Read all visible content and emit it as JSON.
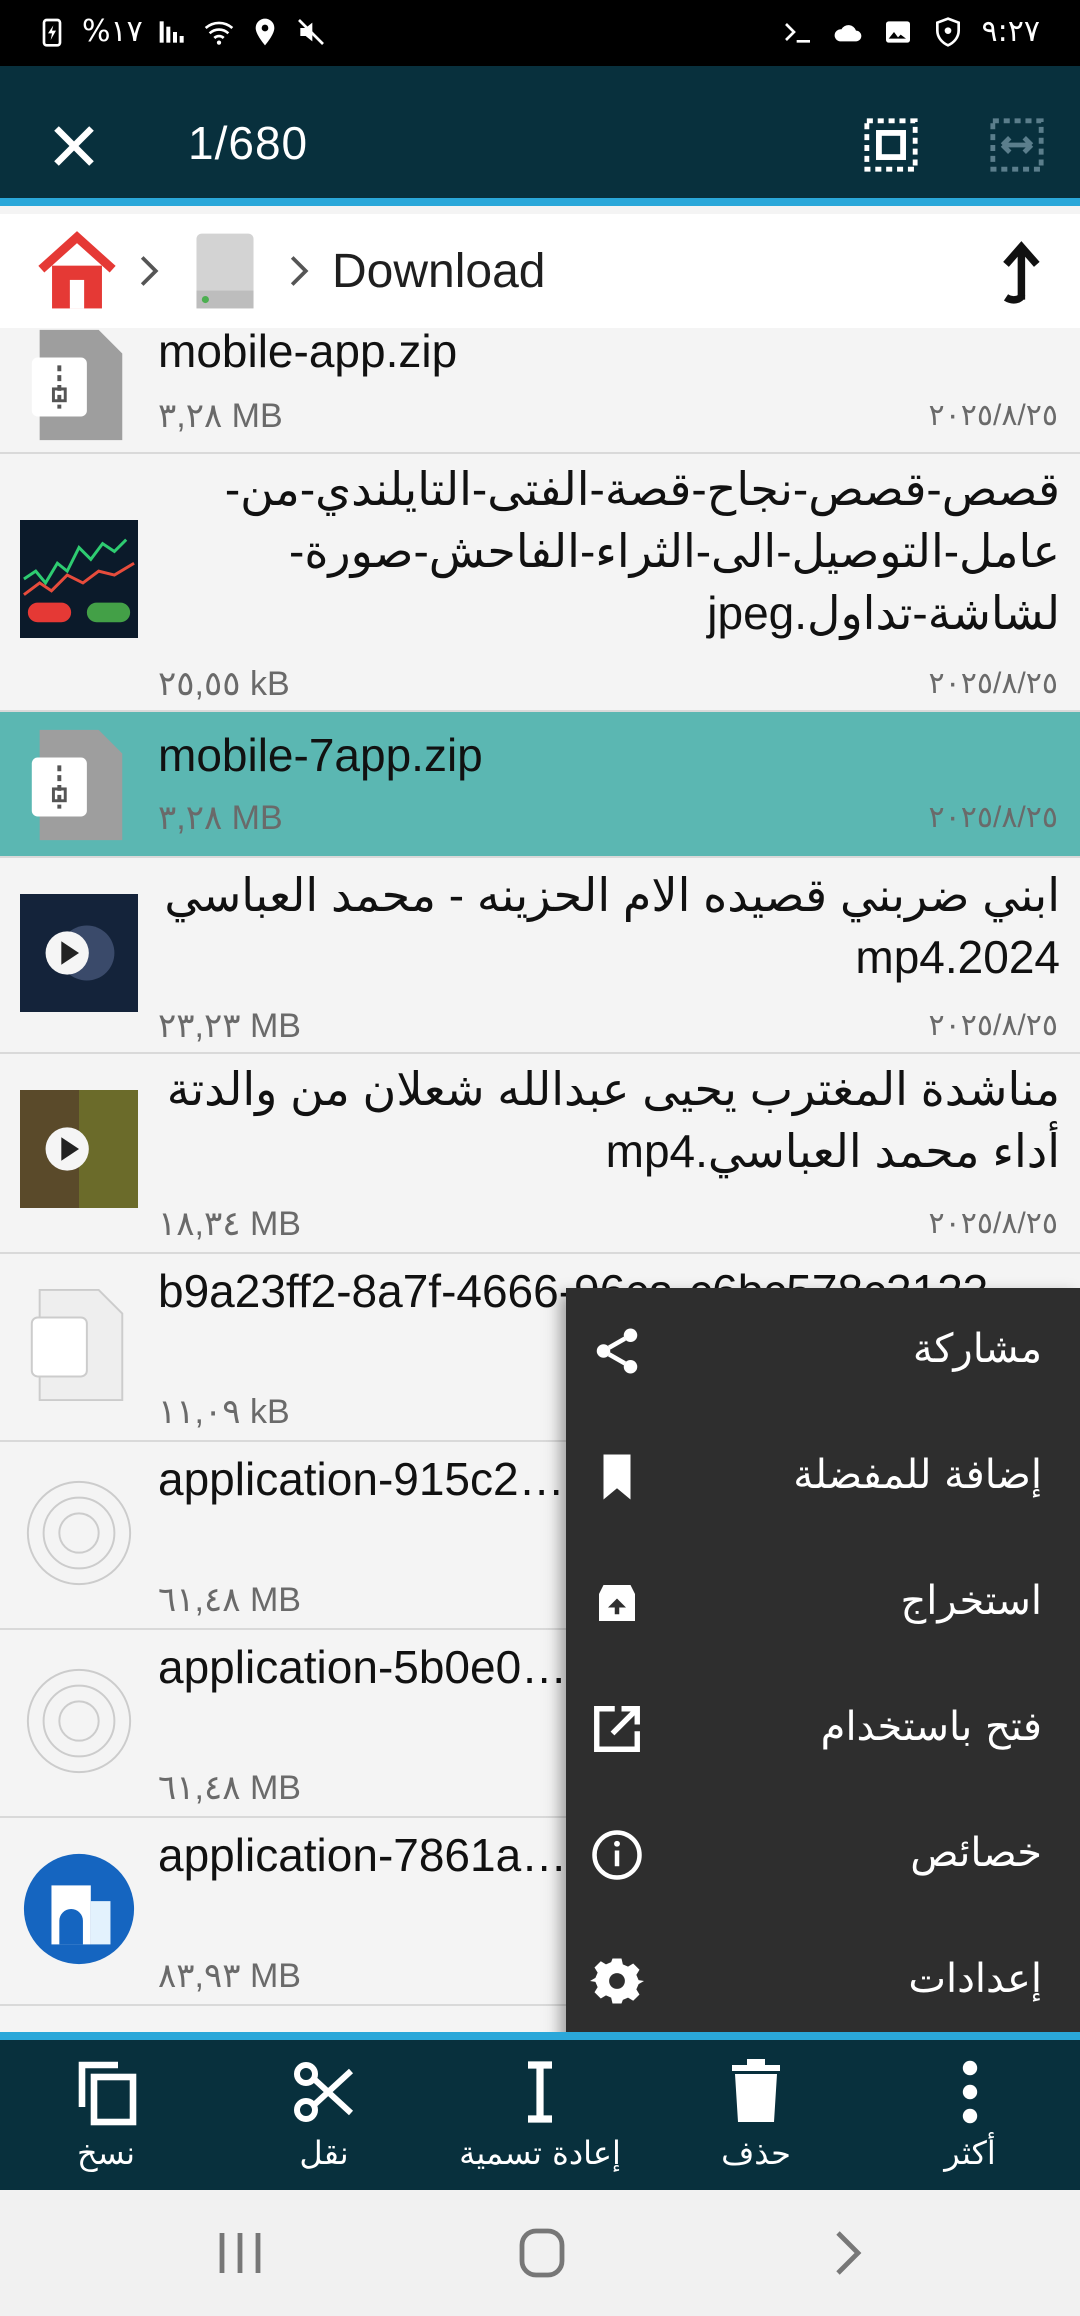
{
  "status_bar": {
    "left_text": "%١٧",
    "time": "٩:٢٧",
    "icons_left": [
      "battery-charging-icon",
      "signal-icon",
      "wifi-icon",
      "location-icon",
      "mute-icon"
    ],
    "icons_right": [
      "terminal-icon",
      "cloud-icon",
      "gallery-icon",
      "shield-icon"
    ]
  },
  "action_bar": {
    "selection_count": "1/680"
  },
  "breadcrumb": {
    "current_folder": "Download"
  },
  "files": [
    {
      "name": "mobile-app.zip",
      "size": "٣,٢٨ MB",
      "date": "٢٠٢٥/٨/٢٥",
      "type": "zip",
      "rtl": false,
      "selected": false
    },
    {
      "name": "قصص-قصص-نجاح-قصة-الفتى-التايلندي-من-عامل-التوصيل-الى-الثراء-الفاحش-صورة-لشاشة-تداول.jpeg",
      "size": "٢٥,٥٥ kB",
      "date": "٢٠٢٥/٨/٢٥",
      "type": "image",
      "rtl": true,
      "selected": false
    },
    {
      "name": "mobile-7app.zip",
      "size": "٣,٢٨ MB",
      "date": "٢٠٢٥/٨/٢٥",
      "type": "zip",
      "rtl": false,
      "selected": true
    },
    {
      "name": "ابني ضربني قصيده الام الحزينه - محمد العباسي 2024.mp4",
      "size": "٢٣,٢٣ MB",
      "date": "٢٠٢٥/٨/٢٥",
      "type": "video",
      "rtl": true,
      "selected": false
    },
    {
      "name": "مناشدة المغترب يحيى عبدالله شعلان من والدتة أداء محمد العباسي.mp4",
      "size": "١٨,٣٤ MB",
      "date": "٢٠٢٥/٨/٢٥",
      "type": "video",
      "rtl": true,
      "selected": false
    },
    {
      "name": "b9a23ff2-8a7f-4666-96ca-c6bc578c2123",
      "size": "١١,٠٩ kB",
      "date": "",
      "type": "blank",
      "rtl": false,
      "selected": false
    },
    {
      "name": "application-915c2…3aaa017e387b.apk",
      "size": "٦١,٤٨ MB",
      "date": "",
      "type": "apk",
      "rtl": false,
      "selected": false
    },
    {
      "name": "application-5b0e0…b074a6306d0.apk",
      "size": "٦١,٤٨ MB",
      "date": "",
      "type": "apk",
      "rtl": false,
      "selected": false
    },
    {
      "name": "application-7861a…9be0b95099f0.apk",
      "size": "٨٣,٩٣ MB",
      "date": "",
      "type": "apk-building",
      "rtl": false,
      "selected": false
    }
  ],
  "context_menu": [
    {
      "label": "مشاركة",
      "icon": "share-icon"
    },
    {
      "label": "إضافة للمفضلة",
      "icon": "bookmark-icon"
    },
    {
      "label": "استخراج",
      "icon": "extract-icon"
    },
    {
      "label": "فتح باستخدام",
      "icon": "open-with-icon"
    },
    {
      "label": "خصائص",
      "icon": "info-icon"
    },
    {
      "label": "إعدادات",
      "icon": "settings-icon"
    }
  ],
  "bottom_bar": [
    {
      "label": "نسخ",
      "icon": "copy-icon"
    },
    {
      "label": "نقل",
      "icon": "cut-icon"
    },
    {
      "label": "إعادة تسمية",
      "icon": "rename-icon"
    },
    {
      "label": "حذف",
      "icon": "delete-icon"
    },
    {
      "label": "أكثر",
      "icon": "more-icon"
    }
  ],
  "colors": {
    "toolbar": "#08303d",
    "accent": "#2aa7d9",
    "selected_row": "#5bb7b2",
    "menu_bg": "#2e2e2e"
  }
}
